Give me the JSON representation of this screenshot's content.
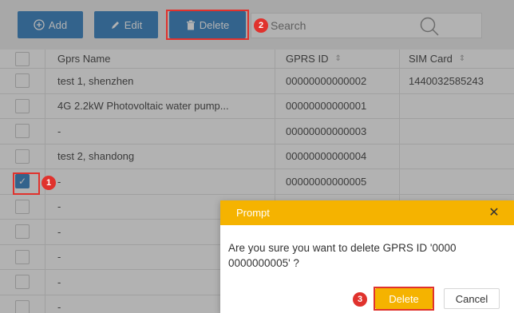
{
  "toolbar": {
    "add_label": "Add",
    "edit_label": "Edit",
    "delete_label": "Delete",
    "search_placeholder": "Search"
  },
  "table": {
    "headers": {
      "name": "Gprs Name",
      "id": "GPRS ID",
      "sim": "SIM Card"
    },
    "rows": [
      {
        "name": "test 1, shenzhen",
        "id": "00000000000002",
        "sim": "1440032585243",
        "checked": false
      },
      {
        "name": "4G 2.2kW Photovoltaic water pump...",
        "id": "00000000000001",
        "sim": "",
        "checked": false
      },
      {
        "name": "-",
        "id": "00000000000003",
        "sim": "",
        "checked": false
      },
      {
        "name": "test 2, shandong",
        "id": "00000000000004",
        "sim": "",
        "checked": false
      },
      {
        "name": "-",
        "id": "00000000000005",
        "sim": "",
        "checked": true
      },
      {
        "name": "-",
        "id": "",
        "sim": "",
        "checked": false
      },
      {
        "name": "-",
        "id": "",
        "sim": "",
        "checked": false
      },
      {
        "name": "-",
        "id": "",
        "sim": "",
        "checked": false
      },
      {
        "name": "-",
        "id": "",
        "sim": "",
        "checked": false
      },
      {
        "name": "-",
        "id": "",
        "sim": "",
        "checked": false
      }
    ]
  },
  "dialog": {
    "title": "Prompt",
    "message": "Are you sure you want to delete GPRS ID '0000 0000000005' ?",
    "confirm_label": "Delete",
    "cancel_label": "Cancel"
  },
  "steps": {
    "one": "1",
    "two": "2",
    "three": "3"
  },
  "colors": {
    "primary": "#4a8fc9",
    "dialog_header": "#f5b300",
    "highlight": "#e0322d"
  }
}
